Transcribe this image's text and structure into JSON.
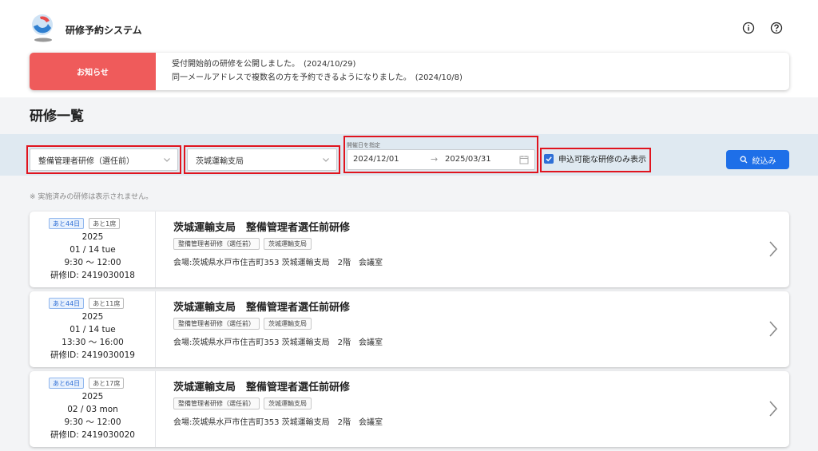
{
  "app": {
    "title": "研修予約システム",
    "icons": {
      "logo": "crane-logo",
      "info": "info-icon",
      "help": "help-icon"
    }
  },
  "notice": {
    "label": "お知らせ",
    "lines": [
      "受付開始前の研修を公開しました。　(2024/10/29)",
      "同一メールアドレスで複数名の方を予約できるようになりました。　(2024/10/8)"
    ]
  },
  "page_title": "研修一覧",
  "filters": {
    "course_select": "整備管理者研修（選任前）",
    "office_select": "茨城運輸支局",
    "date_label": "開催日を指定",
    "date_from": "2024/12/01",
    "date_arrow": "→",
    "date_to": "2025/03/31",
    "available_only_label": "申込可能な研修のみ表示",
    "available_only_checked": true,
    "search_label": "絞込み"
  },
  "note": "※ 実施済みの研修は表示されません。",
  "trainings": [
    {
      "days_left": "あと44日",
      "seats_left": "あと1席",
      "year": "2025",
      "date": "01 / 14  tue",
      "time": "9:30 ～ 12:00",
      "id": "研修ID: 2419030018",
      "title": "茨城運輸支局　整備管理者選任前研修",
      "tags": [
        "整備管理者研修（選任前）",
        "茨城運輸支局"
      ],
      "venue": "会場:茨城県水戸市住吉町353 茨城運輸支局　2階　会議室"
    },
    {
      "days_left": "あと44日",
      "seats_left": "あと11席",
      "year": "2025",
      "date": "01 / 14  tue",
      "time": "13:30 ～ 16:00",
      "id": "研修ID: 2419030019",
      "title": "茨城運輸支局　整備管理者選任前研修",
      "tags": [
        "整備管理者研修（選任前）",
        "茨城運輸支局"
      ],
      "venue": "会場:茨城県水戸市住吉町353 茨城運輸支局　2階　会議室"
    },
    {
      "days_left": "あと64日",
      "seats_left": "あと17席",
      "year": "2025",
      "date": "02 / 03  mon",
      "time": "9:30 ～ 12:00",
      "id": "研修ID: 2419030020",
      "title": "茨城運輸支局　整備管理者選任前研修",
      "tags": [
        "整備管理者研修（選任前）",
        "茨城運輸支局"
      ],
      "venue": "会場:茨城県水戸市住吉町353 茨城運輸支局　2階　会議室"
    }
  ],
  "colors": {
    "notice_red": "#ef5b5b",
    "highlight_red": "#e0141e",
    "primary_blue": "#1e6fe8",
    "filter_bg": "#dfe9f1"
  }
}
